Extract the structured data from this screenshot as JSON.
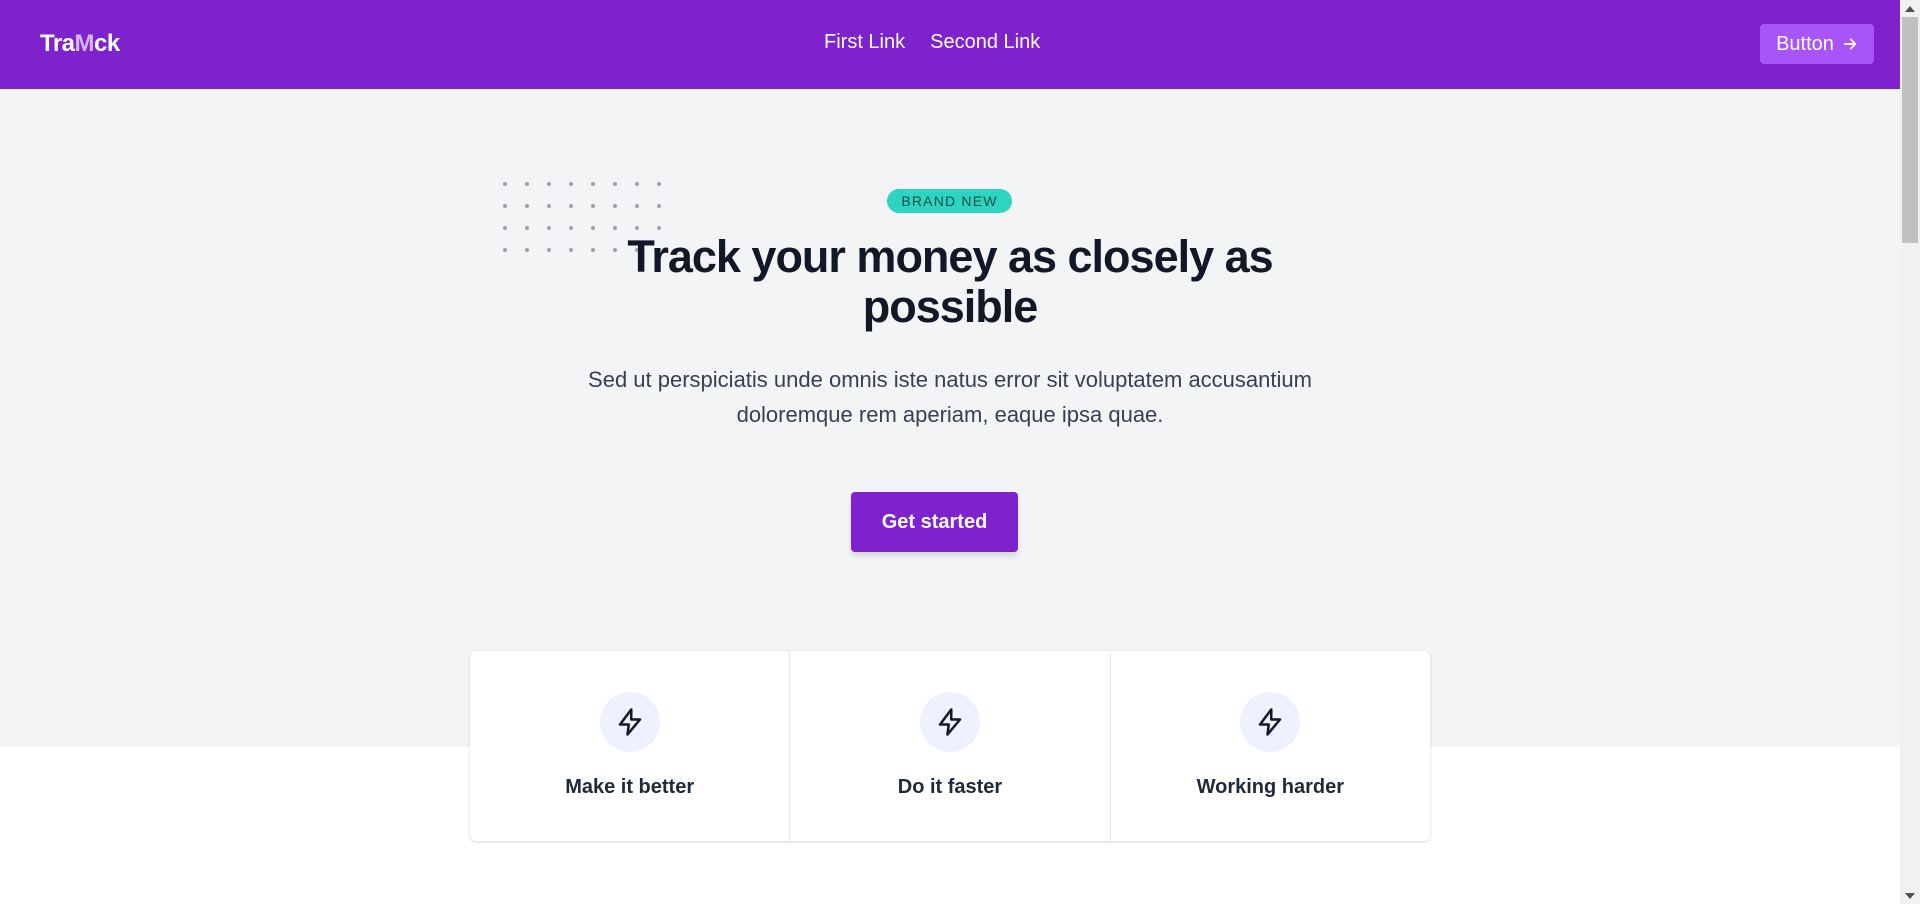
{
  "navbar": {
    "brand_part1": "Tra",
    "brand_highlight": "M",
    "brand_part2": "ck",
    "links": [
      {
        "label": "First Link"
      },
      {
        "label": "Second Link"
      }
    ],
    "button_label": "Button",
    "button_icon": "arrow-right-icon",
    "background_color": "#7e22ce"
  },
  "hero": {
    "badge": "BRAND NEW",
    "headline": "Track your money as closely as possible",
    "subtext": "Sed ut perspiciatis unde omnis iste natus error sit voluptatem accusantium doloremque rem aperiam, eaque ipsa quae.",
    "cta_label": "Get started",
    "background_color": "#f3f4f6"
  },
  "features": [
    {
      "icon": "lightning-icon",
      "title": "Make it better"
    },
    {
      "icon": "lightning-icon",
      "title": "Do it faster"
    },
    {
      "icon": "lightning-icon",
      "title": "Working harder"
    }
  ],
  "colors": {
    "accent": "#7e22ce",
    "button_secondary": "#a855f7",
    "badge": "#2dd4bf"
  }
}
